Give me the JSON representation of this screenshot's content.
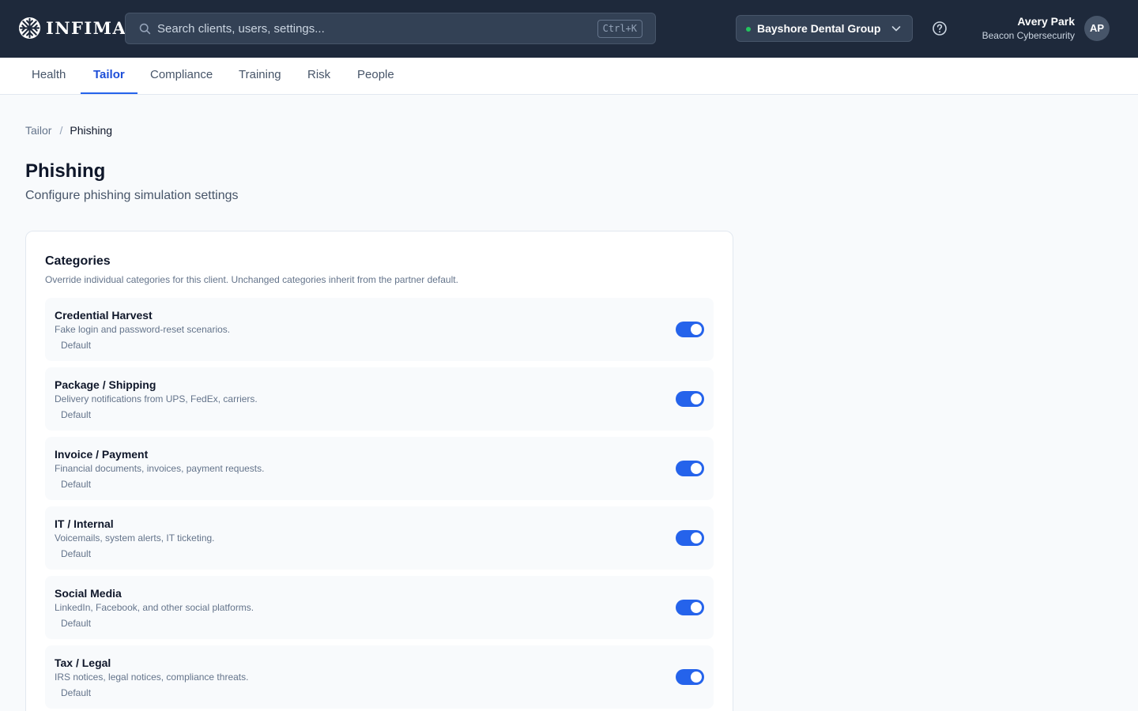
{
  "brand": {
    "name": "INFIMA"
  },
  "search": {
    "placeholder": "Search clients, users, settings...",
    "shortcut": "Ctrl+K"
  },
  "client_selector": {
    "selected": "Bayshore Dental Group",
    "status_color": "#22c55e"
  },
  "user": {
    "name": "Avery Park",
    "organization": "Beacon Cybersecurity",
    "initials": "AP"
  },
  "tabs": [
    {
      "label": "Health",
      "active": false
    },
    {
      "label": "Tailor",
      "active": true
    },
    {
      "label": "Compliance",
      "active": false
    },
    {
      "label": "Training",
      "active": false
    },
    {
      "label": "Risk",
      "active": false
    },
    {
      "label": "People",
      "active": false
    }
  ],
  "breadcrumb": {
    "parent": "Tailor",
    "separator": "/",
    "current": "Phishing"
  },
  "page": {
    "title": "Phishing",
    "subtitle": "Configure phishing simulation settings"
  },
  "categories": {
    "title": "Categories",
    "description": "Override individual categories for this client. Unchanged categories inherit from the partner default.",
    "items": [
      {
        "name": "Credential Harvest",
        "description": "Fake login and password-reset scenarios.",
        "badge": "Default",
        "enabled": true
      },
      {
        "name": "Package / Shipping",
        "description": "Delivery notifications from UPS, FedEx, carriers.",
        "badge": "Default",
        "enabled": true
      },
      {
        "name": "Invoice / Payment",
        "description": "Financial documents, invoices, payment requests.",
        "badge": "Default",
        "enabled": true
      },
      {
        "name": "IT / Internal",
        "description": "Voicemails, system alerts, IT ticketing.",
        "badge": "Default",
        "enabled": true
      },
      {
        "name": "Social Media",
        "description": "LinkedIn, Facebook, and other social platforms.",
        "badge": "Default",
        "enabled": true
      },
      {
        "name": "Tax / Legal",
        "description": "IRS notices, legal notices, compliance threats.",
        "badge": "Default",
        "enabled": true
      }
    ]
  },
  "colors": {
    "accent": "#2563eb",
    "topbar": "#1e293b",
    "active_tab": "#1d4ed8"
  }
}
